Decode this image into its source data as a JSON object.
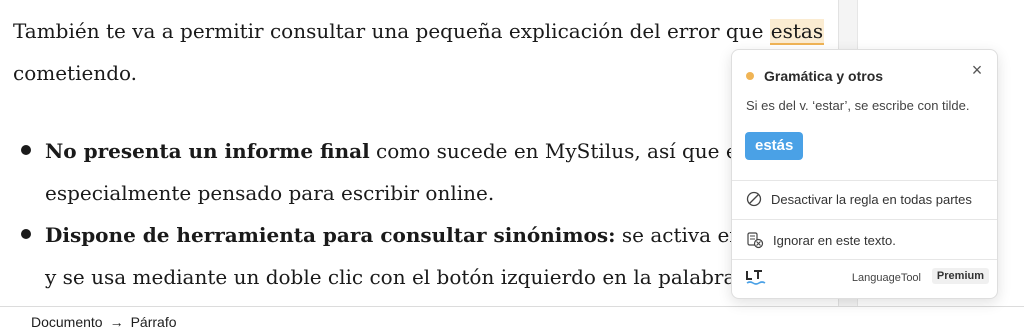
{
  "paragraph": {
    "before": "También te va a permitir consultar una pequeña explicación del error que ",
    "error_word": "estas",
    "after": "cometiendo."
  },
  "bullets": [
    {
      "bold": "No presenta un informe final",
      "rest": " como sucede en MyStilus, así que está",
      "line2": "especialmente pensado para escribir online."
    },
    {
      "bold": "Dispone de herramienta para consultar sinónimos:",
      "rest": " se activa en la configuración",
      "line2": "y se usa mediante un doble clic con el botón izquierdo en la palabra que"
    }
  ],
  "statusbar": {
    "crumb1": "Documento",
    "arrow": "→",
    "crumb2": "Párrafo"
  },
  "popup": {
    "category": "Gramática y otros",
    "message": "Si es del v. ‘estar’, se escribe con tilde.",
    "suggestion": "estás",
    "disable_rule": "Desactivar la regla en todas partes",
    "ignore_text": "Ignorar en este texto.",
    "brand": "LanguageTool",
    "badge": "Premium",
    "close_glyph": "×",
    "category_color": "#f0b455",
    "button_color": "#4aa1e6"
  }
}
